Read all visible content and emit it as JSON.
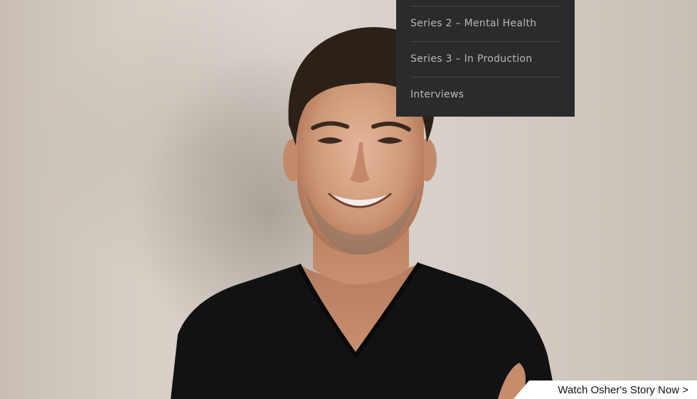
{
  "hero": {
    "photo_subject": "portrait-photo"
  },
  "nav_dropdown": {
    "items": [
      {
        "label": "Series 2 – Mental Health"
      },
      {
        "label": "Series 3 – In Production"
      },
      {
        "label": "Interviews"
      }
    ]
  },
  "cta": {
    "label": "Watch Osher's Story Now >"
  },
  "colors": {
    "dropdown_bg": "#2b2b2c",
    "dropdown_text": "#b8b8b8",
    "cta_bg": "#ffffff",
    "cta_text": "#111111"
  }
}
